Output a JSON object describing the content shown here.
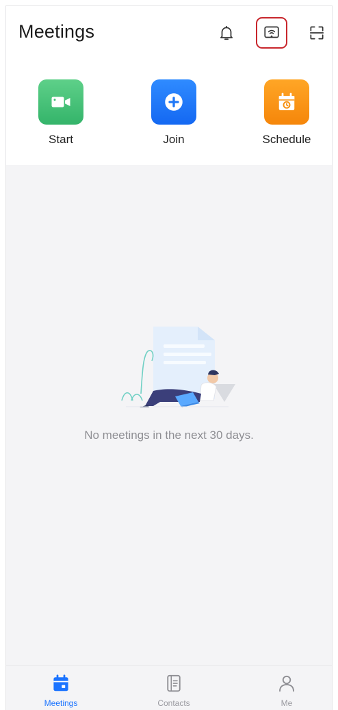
{
  "header": {
    "title": "Meetings",
    "icons": [
      "bell-icon",
      "screen-cast-icon",
      "scan-icon"
    ]
  },
  "actions": [
    {
      "label": "Start",
      "icon": "video-camera-icon",
      "color": "#3fbf74"
    },
    {
      "label": "Join",
      "icon": "plus-circle-icon",
      "color": "#1f78f7"
    },
    {
      "label": "Schedule",
      "icon": "calendar-icon",
      "color": "#f7900f"
    }
  ],
  "empty_state": {
    "message": "No meetings in the next 30 days."
  },
  "tabs": [
    {
      "label": "Meetings",
      "icon": "calendar-tab-icon",
      "active": true
    },
    {
      "label": "Contacts",
      "icon": "contacts-book-icon",
      "active": false
    },
    {
      "label": "Me",
      "icon": "person-icon",
      "active": false
    }
  ],
  "colors": {
    "accent": "#1a73ff",
    "highlight_border": "#c8262c",
    "background": "#f4f4f6"
  }
}
